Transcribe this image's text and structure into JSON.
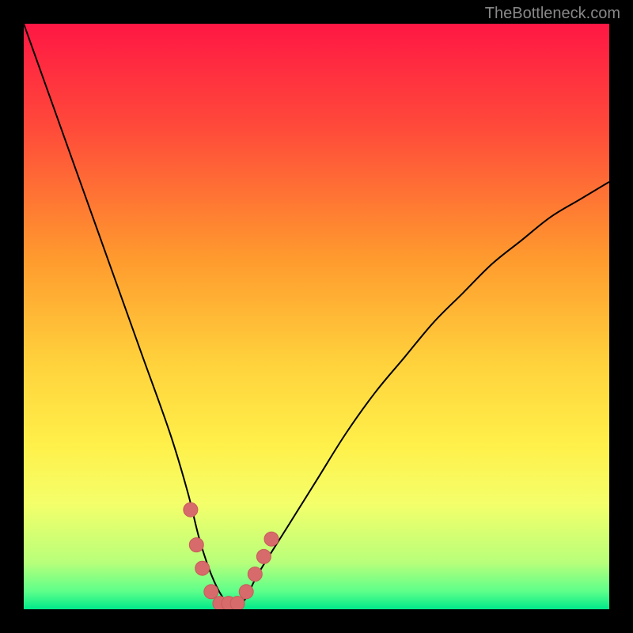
{
  "watermark": "TheBottleneck.com",
  "chart_data": {
    "type": "line",
    "title": "",
    "xlabel": "",
    "ylabel": "",
    "xlim": [
      0,
      100
    ],
    "ylim": [
      0,
      100
    ],
    "grid": false,
    "legend": false,
    "background": {
      "type": "vertical-gradient",
      "stops": [
        {
          "offset": 0.0,
          "color": "#ff1744"
        },
        {
          "offset": 0.18,
          "color": "#ff4b3a"
        },
        {
          "offset": 0.4,
          "color": "#ff9a2e"
        },
        {
          "offset": 0.58,
          "color": "#ffd23c"
        },
        {
          "offset": 0.72,
          "color": "#fff04a"
        },
        {
          "offset": 0.82,
          "color": "#f4ff6a"
        },
        {
          "offset": 0.92,
          "color": "#b8ff7a"
        },
        {
          "offset": 0.97,
          "color": "#5cff8a"
        },
        {
          "offset": 1.0,
          "color": "#00e98a"
        }
      ]
    },
    "series": [
      {
        "name": "bottleneck-curve",
        "stroke": "#000000",
        "stroke_width": 2,
        "x": [
          0,
          5,
          10,
          15,
          20,
          25,
          28,
          30,
          32,
          34,
          36,
          38,
          40,
          45,
          50,
          55,
          60,
          65,
          70,
          75,
          80,
          85,
          90,
          95,
          100
        ],
        "values": [
          100,
          86,
          72,
          58,
          44,
          30,
          20,
          12,
          6,
          2,
          0,
          2,
          6,
          14,
          22,
          30,
          37,
          43,
          49,
          54,
          59,
          63,
          67,
          70,
          73
        ]
      }
    ],
    "markers": {
      "name": "highlight-points",
      "fill": "#d76a6a",
      "stroke": "#c85b5b",
      "radius": 9,
      "points": [
        {
          "x": 28.5,
          "y": 17
        },
        {
          "x": 29.5,
          "y": 11
        },
        {
          "x": 30.5,
          "y": 7
        },
        {
          "x": 32.0,
          "y": 3
        },
        {
          "x": 33.5,
          "y": 1
        },
        {
          "x": 35.0,
          "y": 1
        },
        {
          "x": 36.5,
          "y": 1
        },
        {
          "x": 38.0,
          "y": 3
        },
        {
          "x": 39.5,
          "y": 6
        },
        {
          "x": 41.0,
          "y": 9
        },
        {
          "x": 42.3,
          "y": 12
        }
      ]
    }
  }
}
